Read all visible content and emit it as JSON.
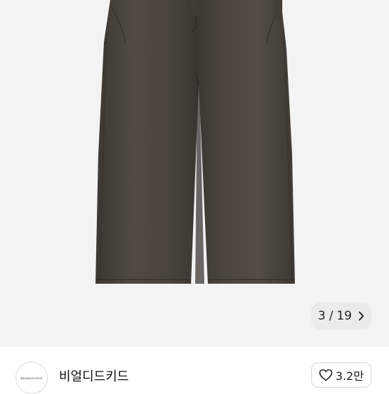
{
  "gallery": {
    "current": "3",
    "separator": "/",
    "total": "19",
    "next_icon": "chevron-right-icon"
  },
  "seller": {
    "avatar_text": "BEAEDDYKID",
    "name": "비얼디드키드"
  },
  "like": {
    "icon": "heart-outline-icon",
    "count": "3.2만"
  },
  "colors": {
    "background": "#f3f3f3",
    "pants": "#4d4740",
    "pants_shadow": "#3a352f"
  }
}
